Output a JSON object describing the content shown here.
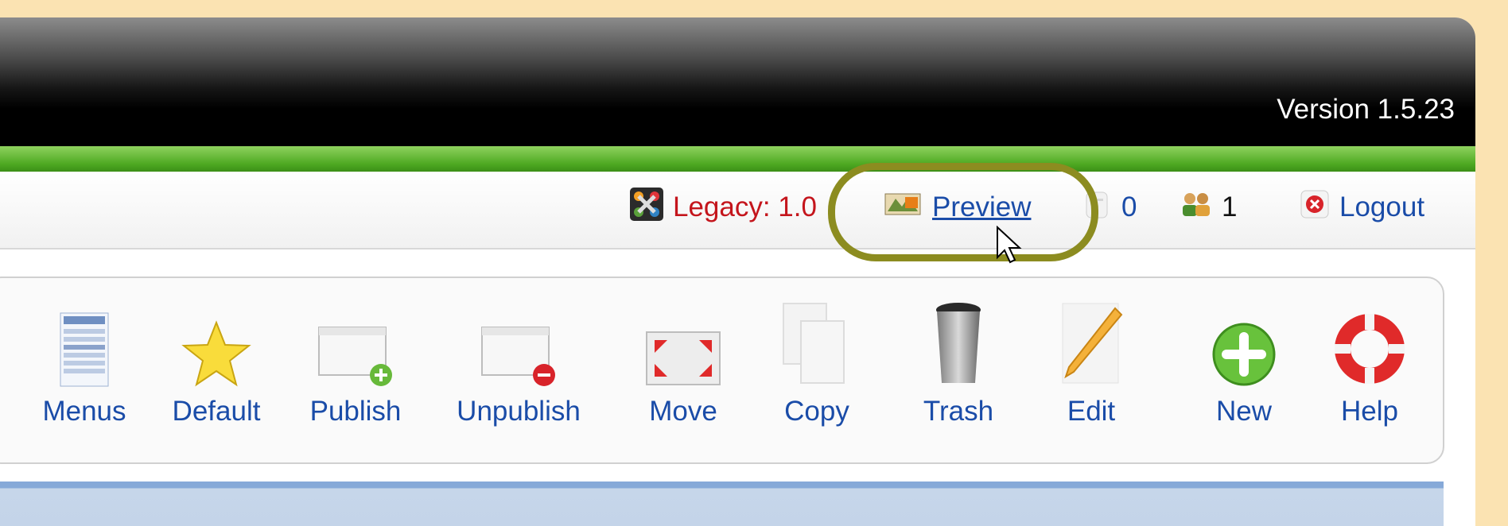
{
  "header": {
    "version": "Version 1.5.23"
  },
  "status": {
    "legacy": "Legacy: 1.0",
    "preview": "Preview",
    "messages_count": "0",
    "users_count": "1",
    "logout": "Logout"
  },
  "toolbar": {
    "buttons": [
      {
        "label": "Menus",
        "icon": "menus-icon"
      },
      {
        "label": "Default",
        "icon": "star-icon"
      },
      {
        "label": "Publish",
        "icon": "publish-icon"
      },
      {
        "label": "Unpublish",
        "icon": "unpublish-icon"
      },
      {
        "label": "Move",
        "icon": "move-icon"
      },
      {
        "label": "Copy",
        "icon": "copy-icon"
      },
      {
        "label": "Trash",
        "icon": "trash-icon"
      },
      {
        "label": "Edit",
        "icon": "edit-icon"
      },
      {
        "label": "New",
        "icon": "new-icon"
      },
      {
        "label": "Help",
        "icon": "help-icon"
      }
    ]
  }
}
